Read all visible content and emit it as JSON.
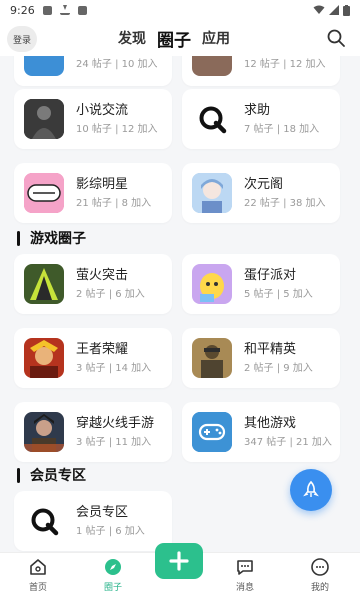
{
  "status_bar": {
    "time": "9:26"
  },
  "header": {
    "login_label": "登录",
    "tabs": [
      {
        "label": "发现",
        "active": false
      },
      {
        "label": "圈子",
        "active": true
      },
      {
        "label": "应用",
        "active": false
      }
    ]
  },
  "partial_row": [
    {
      "meta": "24 帖子 | 10 加入"
    },
    {
      "meta": "12 帖子 | 12 加入"
    }
  ],
  "circles_top": [
    {
      "name": "小说交流",
      "meta": "10 帖子 | 12 加入",
      "icon": "novel-icon"
    },
    {
      "name": "求助",
      "meta": "7 帖子 | 18 加入",
      "icon": "q-logo-icon"
    },
    {
      "name": "影综明星",
      "meta": "21 帖子 | 8 加入",
      "icon": "star-icon"
    },
    {
      "name": "次元阁",
      "meta": "22 帖子 | 38 加入",
      "icon": "anime-icon"
    }
  ],
  "game_section": {
    "title": "游戏圈子",
    "items": [
      {
        "name": "萤火突击",
        "meta": "2 帖子 | 6 加入",
        "icon": "soldier-icon"
      },
      {
        "name": "蛋仔派对",
        "meta": "5 帖子 | 5 加入",
        "icon": "eggy-icon"
      },
      {
        "name": "王者荣耀",
        "meta": "3 帖子 | 14 加入",
        "icon": "hero-icon"
      },
      {
        "name": "和平精英",
        "meta": "2 帖子 | 9 加入",
        "icon": "pubg-icon"
      },
      {
        "name": "穿越火线手游",
        "meta": "3 帖子 | 11 加入",
        "icon": "crossfire-icon"
      },
      {
        "name": "其他游戏",
        "meta": "347 帖子 | 21 加入",
        "icon": "gamepad-icon"
      }
    ]
  },
  "vip_section": {
    "title": "会员专区",
    "items": [
      {
        "name": "会员专区",
        "meta": "1 帖子 | 6 加入",
        "icon": "q-logo-icon"
      }
    ]
  },
  "bottom_nav": [
    {
      "label": "首页",
      "icon": "home-icon"
    },
    {
      "label": "圈子",
      "icon": "compass-icon",
      "active": true
    },
    {
      "label": "add",
      "icon": "plus-icon"
    },
    {
      "label": "消息",
      "icon": "message-icon"
    },
    {
      "label": "我的",
      "icon": "user-icon"
    }
  ],
  "colors": {
    "accent_green": "#2cc08d",
    "fab_blue": "#3a8fef"
  }
}
